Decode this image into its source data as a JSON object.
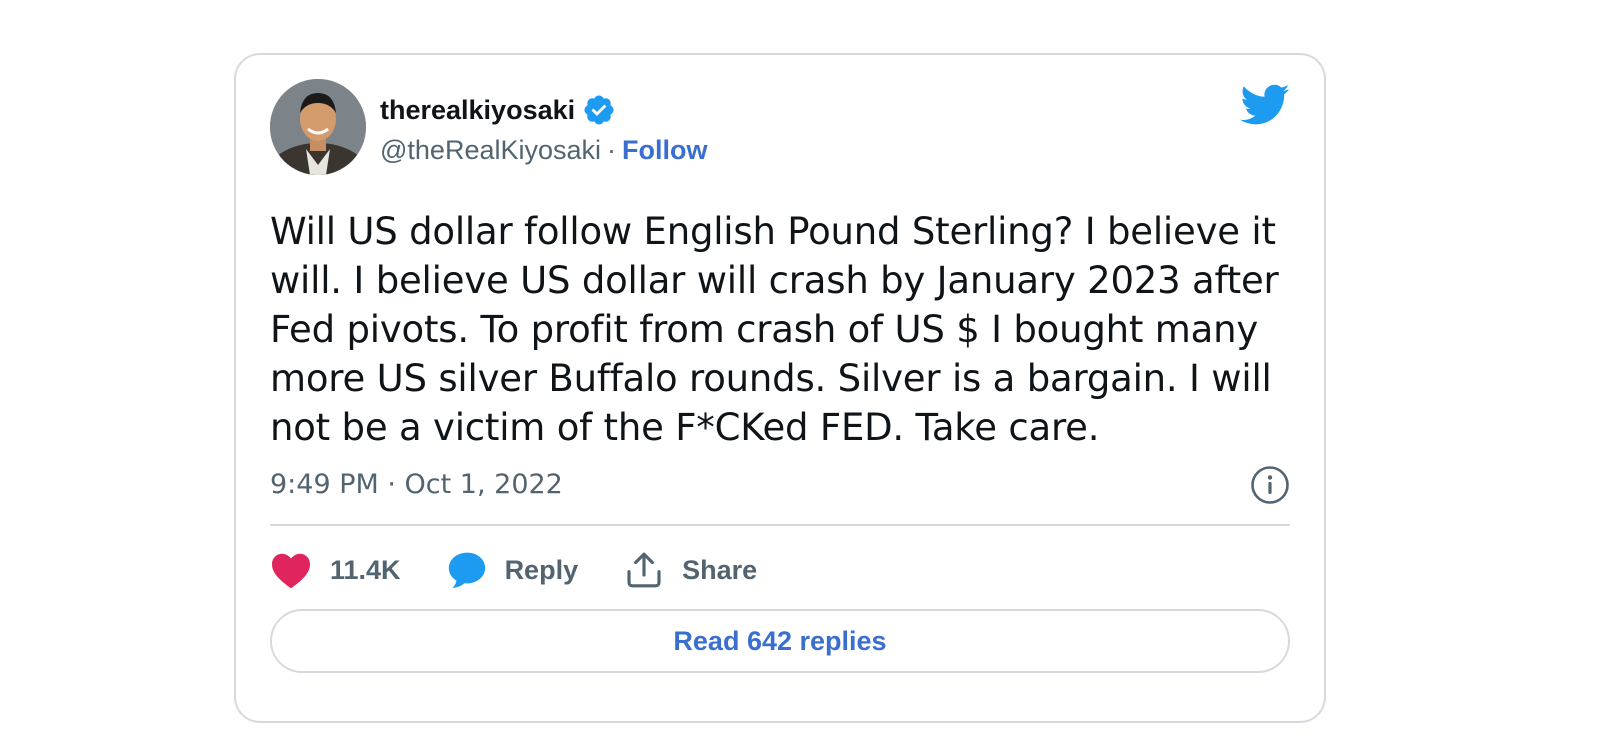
{
  "tweet": {
    "display_name": "therealkiyosaki",
    "handle": "@theRealKiyosaki",
    "separator": "·",
    "follow_label": "Follow",
    "text": "Will US dollar follow English Pound Sterling? I believe it will. I believe US dollar will crash by January 2023 after Fed pivots. To profit from crash of US $ I bought many more US silver Buffalo rounds. Silver is a bargain. I will not be a victim of the F*CKed FED. Take care.",
    "timestamp": "9:49 PM · Oct 1, 2022"
  },
  "actions": {
    "like_count": "11.4K",
    "reply_label": "Reply",
    "share_label": "Share"
  },
  "read_replies_label": "Read 642 replies",
  "icons": {
    "verified": "verified-badge-icon",
    "bird": "twitter-bird-icon",
    "info": "info-icon",
    "heart": "heart-icon",
    "reply": "speech-bubble-icon",
    "share": "share-icon"
  },
  "colors": {
    "link_blue": "#3a6fd0",
    "twitter_blue": "#1d9bf0",
    "heart_pink": "#e0245e",
    "muted_text": "#536471",
    "border": "#d6dade"
  }
}
